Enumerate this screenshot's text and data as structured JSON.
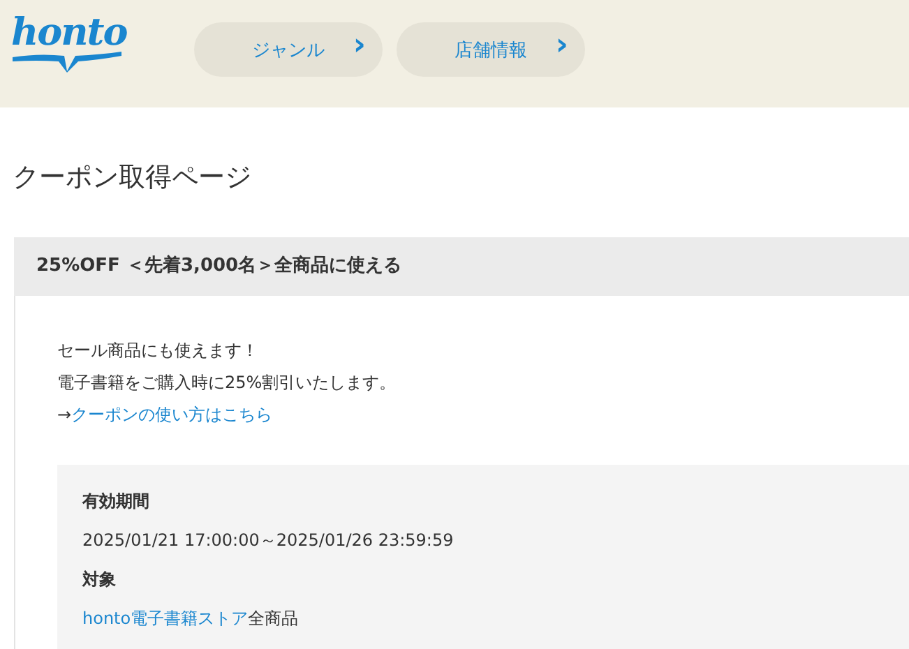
{
  "header": {
    "logo": "honto",
    "nav": [
      {
        "label": "ジャンル",
        "icon": "›"
      },
      {
        "label": "店舗情報",
        "icon": "›"
      }
    ]
  },
  "page_title": "クーポン取得ページ",
  "coupon": {
    "title": "25%OFF ＜先着3,000名＞全商品に使える",
    "lines": [
      "セール商品にも使えます！",
      "電子書籍をご購入時に25%割引いたします。"
    ],
    "link_prefix": "→",
    "link": "クーポンの使い方はこちら",
    "details": [
      {
        "label": "有効期間",
        "value": "2025/01/21 17:00:00～2025/01/26 23:59:59"
      },
      {
        "label": "対象",
        "link": "honto電子書籍ストア",
        "value": "全商品"
      }
    ]
  }
}
